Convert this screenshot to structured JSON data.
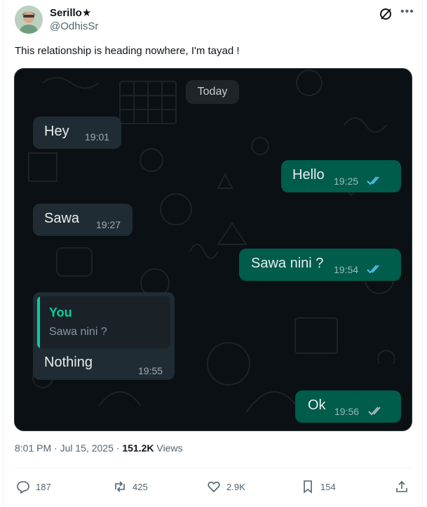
{
  "post": {
    "author_name": "Serillo★",
    "author_handle": "@OdhisSr",
    "text": "This relationship is heading nowhere, I'm tayad !",
    "timestamp": "8:01 PM · Jul 15, 2025",
    "views_count": "151.2K",
    "views_label": "Views"
  },
  "chat": {
    "date_chip": "Today",
    "messages": [
      {
        "direction": "in",
        "text": "Hey",
        "time": "19:01"
      },
      {
        "direction": "out",
        "text": "Hello",
        "time": "19:25",
        "status": "read"
      },
      {
        "direction": "in",
        "text": "Sawa",
        "time": "19:27"
      },
      {
        "direction": "out",
        "text": "Sawa nini ?",
        "time": "19:54",
        "status": "read"
      },
      {
        "direction": "in",
        "text": "Nothing",
        "time": "19:55",
        "reply_to": {
          "author": "You",
          "text": "Sawa nini ?"
        }
      },
      {
        "direction": "out",
        "text": "Ok",
        "time": "19:56",
        "status": "delivered"
      }
    ],
    "colors": {
      "background": "#0b1014",
      "incoming": "#202c33",
      "outgoing": "#005c4b",
      "read_ticks": "#53bdeb",
      "reply_accent": "#06cf9c"
    }
  },
  "actions": {
    "replies": "187",
    "reposts": "425",
    "likes": "2.9K",
    "bookmarks": "154"
  }
}
